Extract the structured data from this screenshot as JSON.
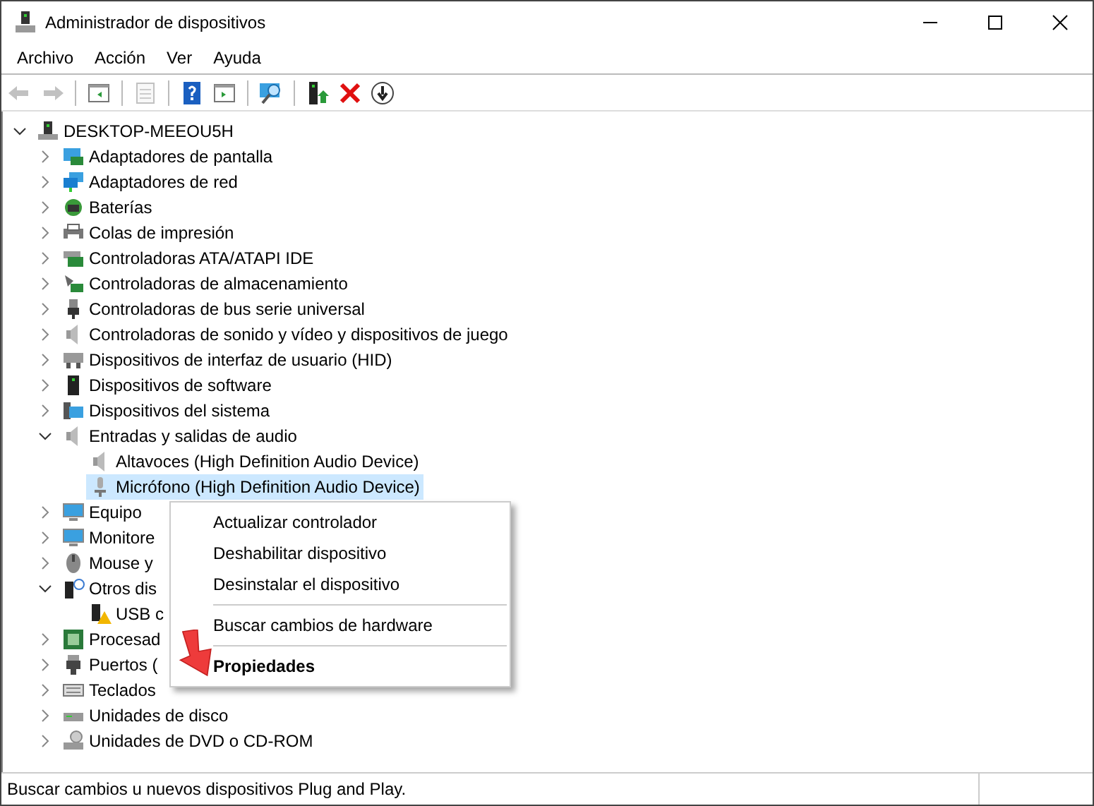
{
  "window": {
    "title": "Administrador de dispositivos"
  },
  "menu_bar": [
    "Archivo",
    "Acción",
    "Ver",
    "Ayuda"
  ],
  "toolbar": [
    {
      "kind": "back",
      "disabled": true
    },
    {
      "kind": "forward",
      "disabled": true
    },
    {
      "kind": "console-tree",
      "disabled": false
    },
    {
      "kind": "properties",
      "disabled": true
    },
    {
      "kind": "help",
      "disabled": false
    },
    {
      "kind": "action-pane",
      "disabled": false
    },
    {
      "kind": "scan",
      "disabled": false
    },
    {
      "kind": "update",
      "disabled": false
    },
    {
      "kind": "uninstall",
      "disabled": false
    },
    {
      "kind": "disable",
      "disabled": false
    }
  ],
  "tree": {
    "label": "DESKTOP-MEEOU5H",
    "expanded": true,
    "selected": false,
    "children": [
      {
        "label": "Adaptadores de pantalla",
        "expanded": false,
        "selected": false
      },
      {
        "label": "Adaptadores de red",
        "expanded": false,
        "selected": false
      },
      {
        "label": "Baterías",
        "expanded": false,
        "selected": false
      },
      {
        "label": "Colas de impresión",
        "expanded": false,
        "selected": false
      },
      {
        "label": "Controladoras ATA/ATAPI IDE",
        "expanded": false,
        "selected": false
      },
      {
        "label": "Controladoras de almacenamiento",
        "expanded": false,
        "selected": false
      },
      {
        "label": "Controladoras de bus serie universal",
        "expanded": false,
        "selected": false
      },
      {
        "label": "Controladoras de sonido y vídeo y dispositivos de juego",
        "expanded": false,
        "selected": false
      },
      {
        "label": "Dispositivos de interfaz de usuario (HID)",
        "expanded": false,
        "selected": false
      },
      {
        "label": "Dispositivos de software",
        "expanded": false,
        "selected": false
      },
      {
        "label": "Dispositivos del sistema",
        "expanded": false,
        "selected": false
      },
      {
        "label": "Entradas y salidas de audio",
        "expanded": true,
        "selected": false,
        "children": [
          {
            "label": "Altavoces (High Definition Audio Device)",
            "selected": false
          },
          {
            "label": "Micrófono (High Definition Audio Device)",
            "selected": true
          }
        ]
      },
      {
        "label": "Equipo",
        "expanded": false,
        "selected": false
      },
      {
        "label": "Monitore",
        "expanded": false,
        "selected": false
      },
      {
        "label": "Mouse y",
        "expanded": false,
        "selected": false
      },
      {
        "label": "Otros dis",
        "expanded": true,
        "selected": false,
        "children": [
          {
            "label": "USB c",
            "selected": false
          }
        ]
      },
      {
        "label": "Procesad",
        "expanded": false,
        "selected": false
      },
      {
        "label": "Puertos (",
        "expanded": false,
        "selected": false
      },
      {
        "label": "Teclados",
        "expanded": false,
        "selected": false
      },
      {
        "label": "Unidades de disco",
        "expanded": false,
        "selected": false
      },
      {
        "label": "Unidades de DVD o CD-ROM",
        "expanded": false,
        "selected": false
      }
    ]
  },
  "context_menu": [
    {
      "kind": "item",
      "label": "Actualizar controlador",
      "default": false
    },
    {
      "kind": "item",
      "label": "Deshabilitar dispositivo",
      "default": false
    },
    {
      "kind": "item",
      "label": "Desinstalar el dispositivo",
      "default": false
    },
    {
      "kind": "separator"
    },
    {
      "kind": "item",
      "label": "Buscar cambios de hardware",
      "default": false
    },
    {
      "kind": "separator"
    },
    {
      "kind": "item",
      "label": "Propiedades",
      "default": true
    }
  ],
  "status_bar": "Buscar cambios u nuevos dispositivos Plug and Play."
}
